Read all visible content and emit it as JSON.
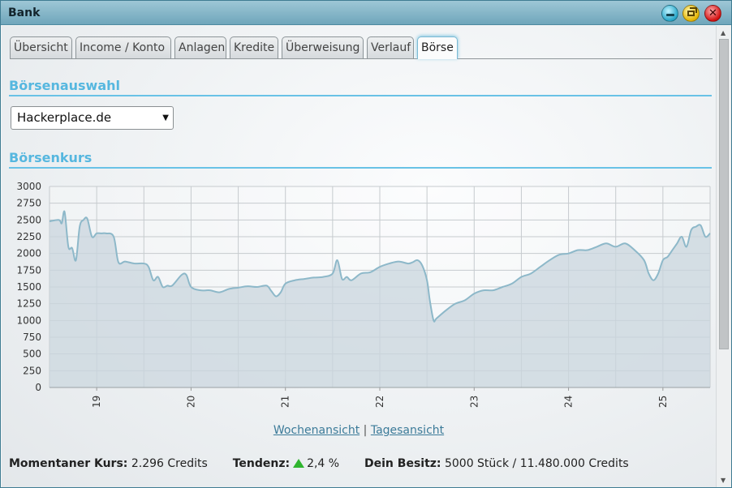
{
  "window": {
    "title": "Bank"
  },
  "tabs": [
    {
      "label": "Übersicht"
    },
    {
      "label": "Income / Konto"
    },
    {
      "label": "Anlagen"
    },
    {
      "label": "Kredite"
    },
    {
      "label": "Überweisung"
    },
    {
      "label": "Verlauf"
    },
    {
      "label": "Börse",
      "active": true
    }
  ],
  "exchange_select": {
    "heading": "Börsenauswahl",
    "value": "Hackerplace.de"
  },
  "chart_section": {
    "heading": "Börsenkurs"
  },
  "links": {
    "week": "Wochenansicht",
    "separator": "|",
    "day": "Tagesansicht"
  },
  "status": {
    "rate_label": "Momentaner Kurs:",
    "rate_value": "2.296 Credits",
    "trend_label": "Tendenz:",
    "trend_value": "2,4 %",
    "holdings_label": "Dein Besitz:",
    "holdings_value": "5000 Stück / 11.480.000 Credits"
  },
  "colors": {
    "accent": "#56b7df",
    "line": "#8db8c9",
    "fill": "#c9d6dd",
    "trend_up": "#2fb52f"
  },
  "chart_data": {
    "type": "area",
    "title": "",
    "xlabel": "",
    "ylabel": "",
    "ylim": [
      0,
      3000
    ],
    "yticks": [
      "0",
      "250",
      "500",
      "750",
      "1000",
      "1250",
      "1500",
      "1750",
      "2000",
      "2250",
      "2500",
      "2750",
      "3000"
    ],
    "xlim": [
      18.5,
      25.5
    ],
    "xticks": [
      "19",
      "20",
      "21",
      "22",
      "23",
      "24",
      "25"
    ],
    "grid": true,
    "x": [
      18.5,
      18.6,
      18.63,
      18.66,
      18.7,
      18.74,
      18.78,
      18.82,
      18.86,
      18.9,
      18.95,
      19.0,
      19.05,
      19.1,
      19.18,
      19.23,
      19.3,
      19.4,
      19.5,
      19.55,
      19.6,
      19.65,
      19.7,
      19.75,
      19.8,
      19.9,
      19.95,
      20.0,
      20.1,
      20.2,
      20.3,
      20.4,
      20.5,
      20.6,
      20.7,
      20.8,
      20.85,
      20.9,
      20.95,
      21.0,
      21.1,
      21.2,
      21.3,
      21.4,
      21.5,
      21.55,
      21.6,
      21.65,
      21.7,
      21.8,
      21.9,
      22.0,
      22.1,
      22.2,
      22.3,
      22.35,
      22.4,
      22.45,
      22.5,
      22.53,
      22.57,
      22.6,
      22.7,
      22.8,
      22.9,
      23.0,
      23.1,
      23.2,
      23.3,
      23.4,
      23.5,
      23.6,
      23.7,
      23.8,
      23.9,
      24.0,
      24.1,
      24.2,
      24.3,
      24.4,
      24.5,
      24.6,
      24.7,
      24.8,
      24.85,
      24.9,
      24.95,
      25.0,
      25.05,
      25.1,
      25.15,
      25.2,
      25.25,
      25.3,
      25.35,
      25.4,
      25.45,
      25.5
    ],
    "y": [
      2480,
      2500,
      2450,
      2620,
      2100,
      2080,
      1900,
      2400,
      2500,
      2520,
      2250,
      2300,
      2300,
      2300,
      2250,
      1870,
      1880,
      1850,
      1850,
      1800,
      1600,
      1650,
      1500,
      1520,
      1520,
      1680,
      1680,
      1500,
      1450,
      1450,
      1420,
      1470,
      1490,
      1510,
      1500,
      1520,
      1440,
      1360,
      1420,
      1550,
      1600,
      1620,
      1640,
      1650,
      1700,
      1900,
      1620,
      1650,
      1600,
      1700,
      1720,
      1800,
      1850,
      1880,
      1850,
      1870,
      1900,
      1820,
      1600,
      1300,
      1000,
      1030,
      1150,
      1250,
      1300,
      1400,
      1450,
      1450,
      1500,
      1550,
      1650,
      1700,
      1800,
      1900,
      1980,
      2000,
      2050,
      2050,
      2100,
      2150,
      2100,
      2150,
      2050,
      1900,
      1700,
      1600,
      1700,
      1900,
      1950,
      2050,
      2150,
      2250,
      2100,
      2350,
      2400,
      2420,
      2250,
      2300
    ]
  }
}
